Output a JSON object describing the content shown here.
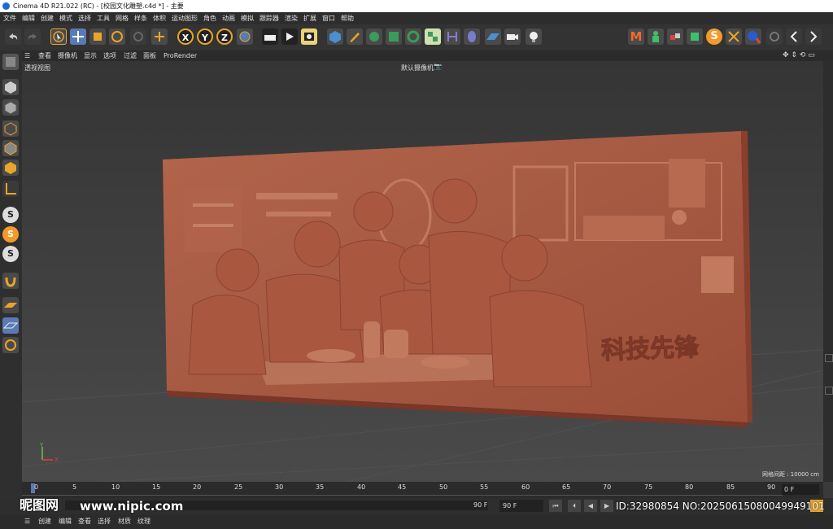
{
  "window": {
    "title": "Cinema 4D R21.022 (RC) - [校园文化雕塑.c4d *] - 主要"
  },
  "menu": [
    "文件",
    "编辑",
    "创建",
    "模式",
    "选择",
    "工具",
    "网格",
    "样条",
    "体积",
    "运动图形",
    "角色",
    "动画",
    "模拟",
    "跟踪器",
    "渲染",
    "扩展",
    "窗口",
    "帮助"
  ],
  "toolbar": {
    "axis_x": "X",
    "axis_y": "Y",
    "axis_z": "Z",
    "right_m": "M",
    "right_s": "S"
  },
  "lefttools": {
    "s1": "S",
    "s2": "S",
    "s3": "S"
  },
  "viewport_menu": [
    "查看",
    "摄像机",
    "显示",
    "选项",
    "过滤",
    "面板",
    "ProRender"
  ],
  "viewport": {
    "label": "透视视图",
    "camera": "默认摄像机",
    "camera_icon": "camera-icon",
    "grid_spacing": "网格间距 : 10000 cm",
    "relief_text": "科技先锋",
    "axis_y": "Y",
    "axis_x": "X"
  },
  "timeline": {
    "ticks": [
      "0",
      "5",
      "10",
      "15",
      "20",
      "25",
      "30",
      "35",
      "40",
      "45",
      "50",
      "55",
      "60",
      "65",
      "70",
      "75",
      "80",
      "85",
      "90"
    ],
    "current_frame": "0 F"
  },
  "transport": {
    "end_frame": "90 F",
    "end_frame_field": "90 F"
  },
  "bottom_menu": [
    "创建",
    "编辑",
    "查看",
    "选择",
    "材质",
    "纹理"
  ],
  "watermark": {
    "logo": "昵图网",
    "url": "www.nipic.com",
    "id": "ID:32980854 NO:20250615080049949101"
  },
  "colors": {
    "accent": "#e8a52a",
    "relief": "#a85a42",
    "bg": "#3e3e3e"
  }
}
